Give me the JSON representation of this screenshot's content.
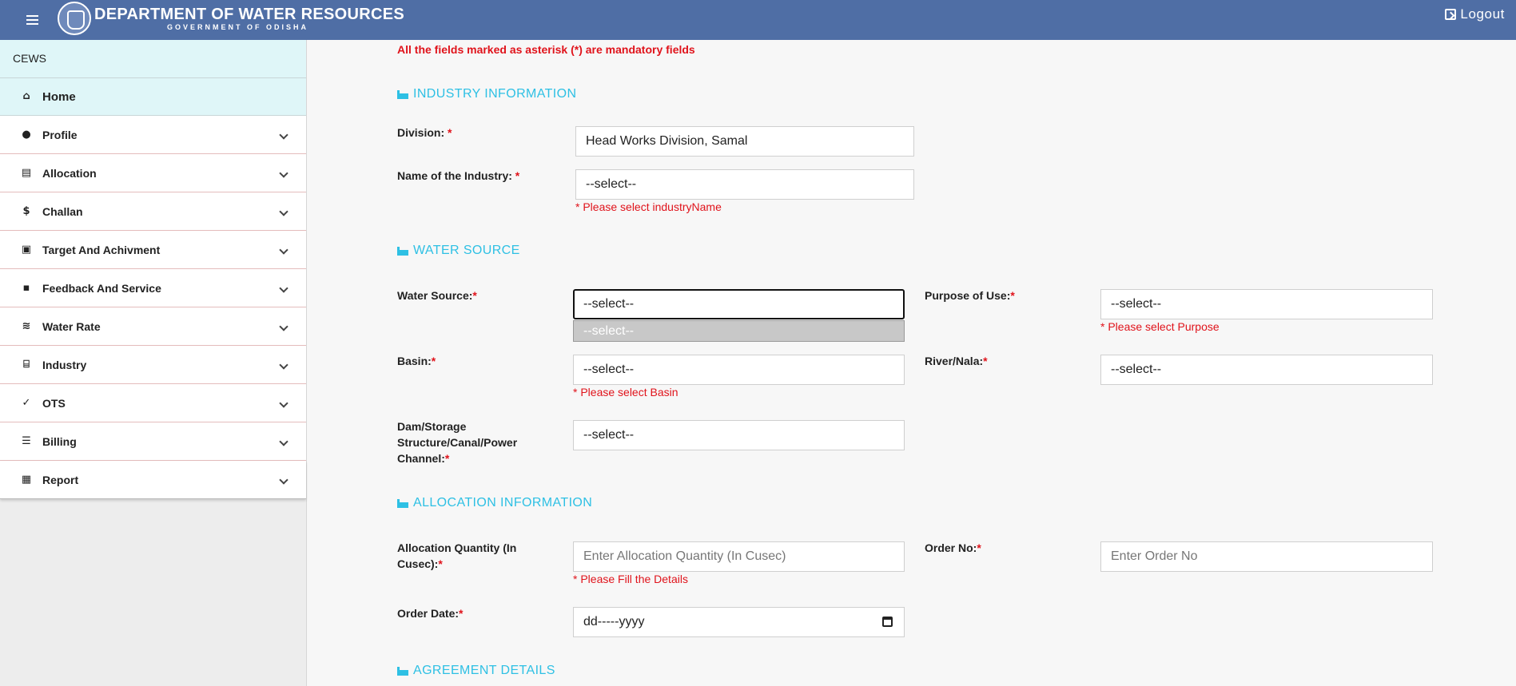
{
  "header": {
    "title": "DEPARTMENT OF WATER RESOURCES",
    "subtitle": "GOVERNMENT OF ODISHA",
    "logout_label": "Logout"
  },
  "sidebar": {
    "heading": "CEWS",
    "home_label": "Home",
    "items": [
      {
        "label": "Profile",
        "icon": "user-circle-icon"
      },
      {
        "label": "Allocation",
        "icon": "document-icon"
      },
      {
        "label": "Challan",
        "icon": "dollar-icon"
      },
      {
        "label": "Target And Achivment",
        "icon": "briefcase-icon"
      },
      {
        "label": "Feedback And Service",
        "icon": "feedback-icon"
      },
      {
        "label": "Water Rate",
        "icon": "waves-icon"
      },
      {
        "label": "Industry",
        "icon": "bank-icon"
      },
      {
        "label": "OTS",
        "icon": "check-icon"
      },
      {
        "label": "Billing",
        "icon": "list-icon"
      },
      {
        "label": "Report",
        "icon": "library-icon"
      }
    ]
  },
  "form": {
    "mandatory_note": "All the fields marked as asterisk (*) are mandatory fields",
    "sections": {
      "industry": "INDUSTRY INFORMATION",
      "water_source": "WATER SOURCE",
      "allocation": "ALLOCATION INFORMATION",
      "agreement": "AGREEMENT DETAILS"
    },
    "division": {
      "label": "Division:",
      "value": "Head Works Division, Samal"
    },
    "industry_name": {
      "label": "Name of the Industry:",
      "value": "--select--",
      "error": "* Please select industryName"
    },
    "water_source": {
      "label": "Water Source:",
      "value": "--select--",
      "option_highlight": "--select--"
    },
    "purpose": {
      "label": "Purpose of Use:",
      "value": "--select--",
      "error": "* Please select Purpose"
    },
    "basin": {
      "label": "Basin:",
      "value": "--select--",
      "error": "* Please select Basin"
    },
    "river": {
      "label": "River/Nala:",
      "value": "--select--"
    },
    "dam": {
      "label_lines": [
        "Dam/Storage",
        "Structure/Canal/Power",
        "Channel:"
      ],
      "value": "--select--"
    },
    "allocation_qty": {
      "label_lines": [
        "Allocation Quantity (In",
        "Cusec):"
      ],
      "placeholder": "Enter Allocation Quantity (In Cusec)",
      "error": "* Please Fill the Details"
    },
    "order_no": {
      "label": "Order No:",
      "placeholder": "Enter Order No"
    },
    "order_date": {
      "label": "Order Date:",
      "value": "dd-----yyyy"
    },
    "required_mark": "*"
  }
}
